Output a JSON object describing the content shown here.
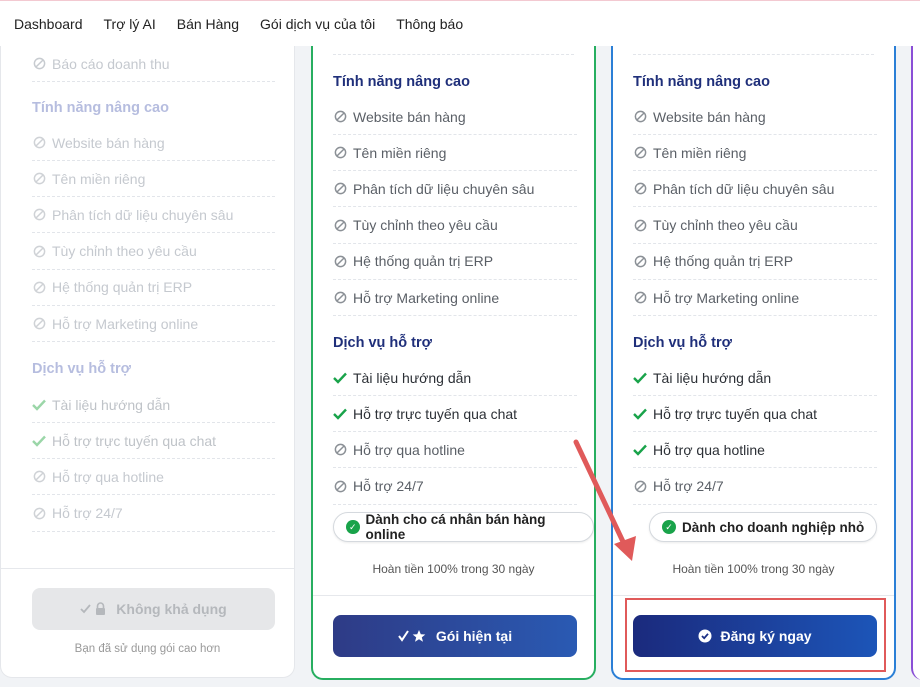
{
  "nav": {
    "items": [
      "Dashboard",
      "Trợ lý AI",
      "Bán Hàng",
      "Gói dịch vụ của tôi",
      "Thông báo"
    ]
  },
  "card1": {
    "top_feature": "Báo cáo doanh thu",
    "advanced_title": "Tính năng nâng cao",
    "advanced": [
      "Website bán hàng",
      "Tên miền riêng",
      "Phân tích dữ liệu chuyên sâu",
      "Tùy chỉnh theo yêu cầu",
      "Hệ thống quản trị ERP",
      "Hỗ trợ Marketing online"
    ],
    "support_title": "Dịch vụ hỗ trợ",
    "support": [
      "Tài liệu hướng dẫn",
      "Hỗ trợ trực tuyến qua chat",
      "Hỗ trợ qua hotline",
      "Hỗ trợ 24/7"
    ],
    "button": "Không khả dụng",
    "note": "Bạn đã sử dụng gói cao hơn"
  },
  "card2": {
    "advanced_title": "Tính năng nâng cao",
    "advanced": [
      "Website bán hàng",
      "Tên miền riêng",
      "Phân tích dữ liệu chuyên sâu",
      "Tùy chỉnh theo yêu cầu",
      "Hệ thống quản trị ERP",
      "Hỗ trợ Marketing online"
    ],
    "support_title": "Dịch vụ hỗ trợ",
    "support": [
      "Tài liệu hướng dẫn",
      "Hỗ trợ trực tuyến qua chat",
      "Hỗ trợ qua hotline",
      "Hỗ trợ 24/7"
    ],
    "badge": "Dành cho cá nhân bán hàng online",
    "refund": "Hoàn tiền 100% trong 30 ngày",
    "button": "Gói hiện tại"
  },
  "card3": {
    "advanced_title": "Tính năng nâng cao",
    "advanced": [
      "Website bán hàng",
      "Tên miền riêng",
      "Phân tích dữ liệu chuyên sâu",
      "Tùy chỉnh theo yêu cầu",
      "Hệ thống quản trị ERP",
      "Hỗ trợ Marketing online"
    ],
    "support_title": "Dịch vụ hỗ trợ",
    "support": [
      "Tài liệu hướng dẫn",
      "Hỗ trợ trực tuyến qua chat",
      "Hỗ trợ qua hotline",
      "Hỗ trợ 24/7"
    ],
    "badge": "Dành cho doanh nghiệp nhỏ",
    "refund": "Hoàn tiền 100% trong 30 ngày",
    "button": "Đăng ký ngay"
  },
  "colors": {
    "accent_green": "#27ae60",
    "accent_blue": "#2b7fd6",
    "accent_purple": "#8a4fd6",
    "check_green": "#19a34a",
    "annotation_red": "#e05a5a"
  }
}
